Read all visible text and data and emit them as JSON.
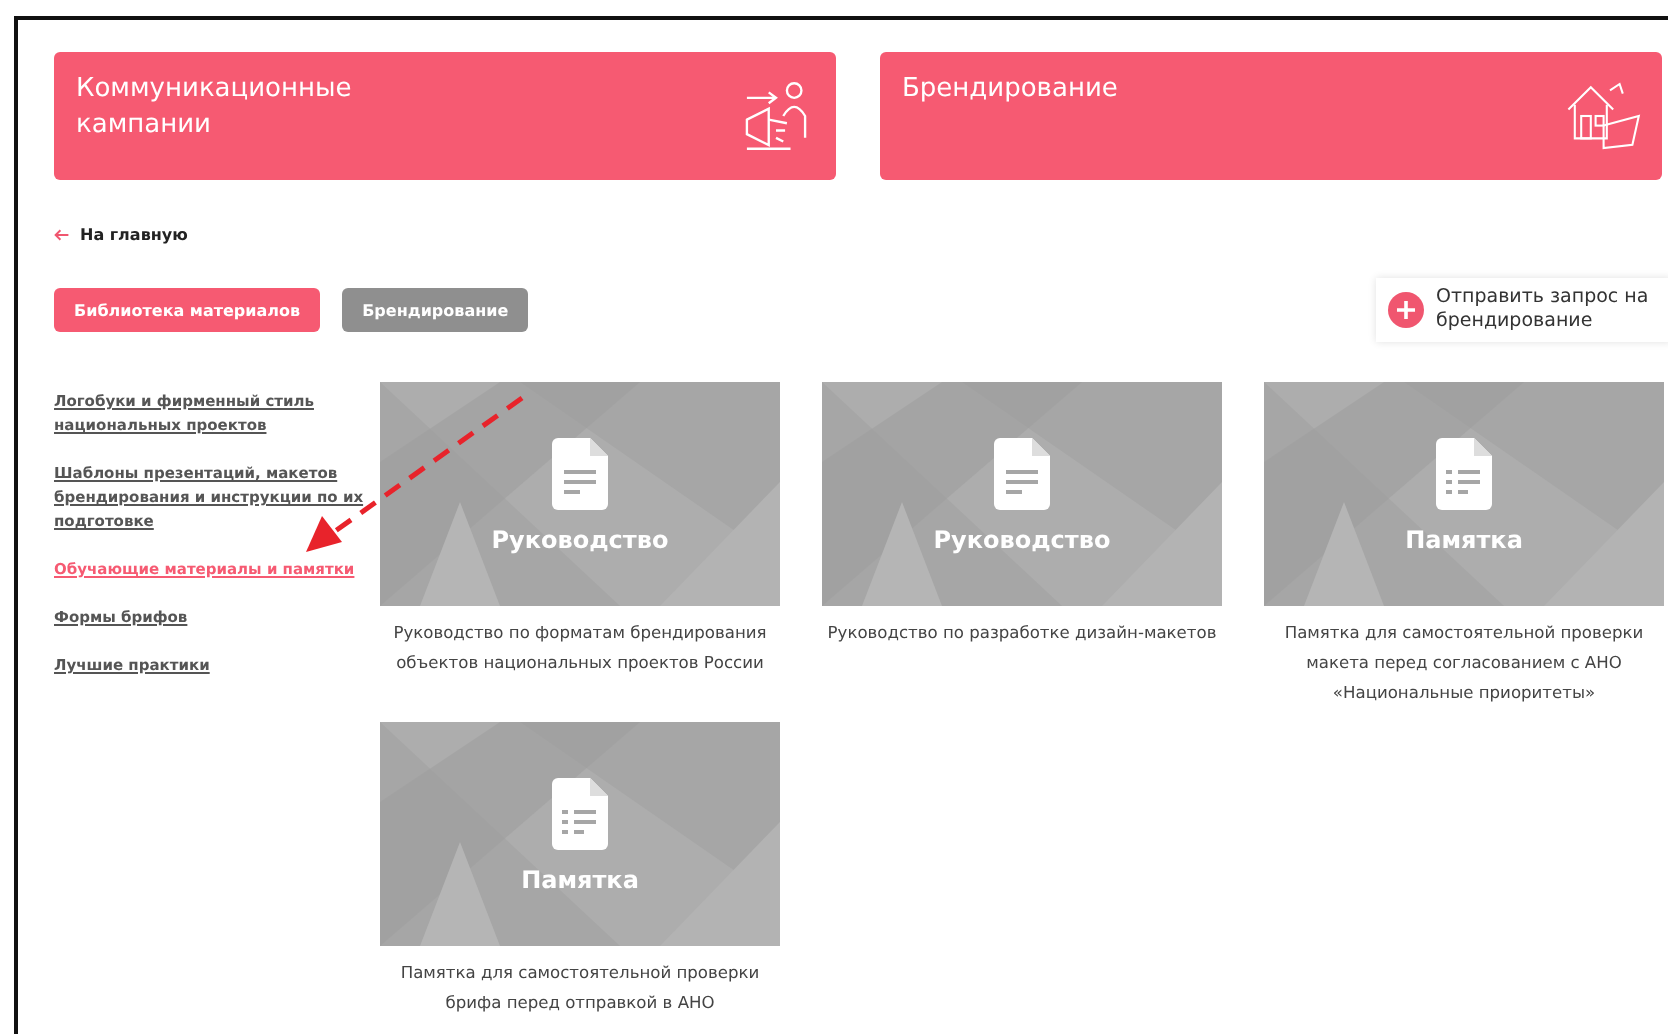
{
  "top_cards": [
    {
      "title": "Коммуникационные кампании",
      "kind": "campaign"
    },
    {
      "title": "Брендирование",
      "kind": "branding"
    }
  ],
  "back_link": "На главную",
  "tabs": [
    {
      "label": "Библиотека материалов",
      "selected": true
    },
    {
      "label": "Брендирование",
      "selected": false
    }
  ],
  "request_button": "Отправить запрос на брендирование",
  "sidebar": {
    "items": [
      {
        "label": "Логобуки и фирменный стиль национальных проектов",
        "selected": false
      },
      {
        "label": "Шаблоны презентаций, макетов брендирования и инструкции по их подготовке",
        "selected": false
      },
      {
        "label": "Обучающие материалы и памятки",
        "selected": true
      },
      {
        "label": "Формы брифов",
        "selected": false
      },
      {
        "label": "Лучшие практики",
        "selected": false
      }
    ]
  },
  "materials": [
    {
      "kind": "guide",
      "type_label": "Руководство",
      "caption": "Руководство по форматам брендирования объектов национальных проектов России"
    },
    {
      "kind": "guide",
      "type_label": "Руководство",
      "caption": "Руководство по разработке дизайн-макетов"
    },
    {
      "kind": "memo",
      "type_label": "Памятка",
      "caption": "Памятка для самостоятельной проверки макета перед согласованием с АНО «Национальные приоритеты»"
    },
    {
      "kind": "memo",
      "type_label": "Памятка",
      "caption": "Памятка для самостоятельной проверки брифа перед отправкой в АНО"
    }
  ]
}
